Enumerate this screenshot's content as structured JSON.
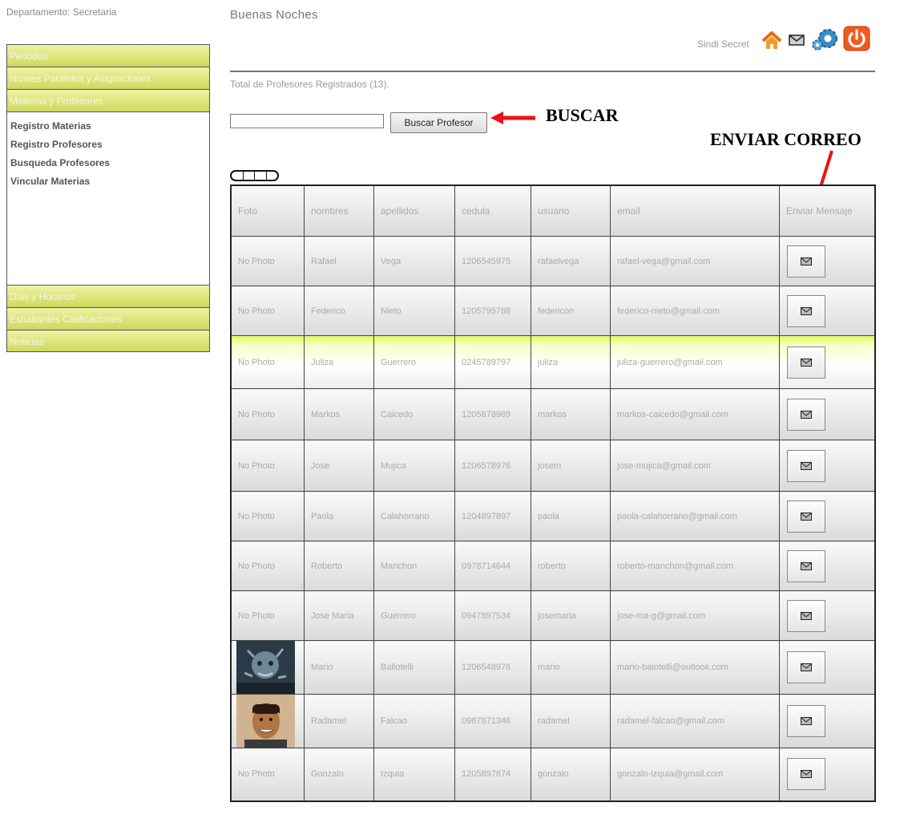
{
  "sidebar": {
    "department": "Departamento: Secretaria",
    "menu_top": [
      "Periodos",
      "Niveles Paralelos y Asignaciones",
      "Materias y Profesores"
    ],
    "sub_items": [
      "Registro Materias",
      "Registro Profesores",
      "Busqueda Profesores",
      "Vincular Materias"
    ],
    "menu_bottom": [
      "Dias y Horarios",
      "Estudiantes Calificaciones",
      "Noticias"
    ]
  },
  "header": {
    "greeting": "Buenas Noches",
    "user": "Sindi Secret",
    "icons": [
      "home-icon",
      "mail-icon",
      "settings-icon",
      "power-icon"
    ]
  },
  "main": {
    "total_text": "Total de Profesores Registrados (13).",
    "search": {
      "value": "",
      "button_label": "Buscar Profesor"
    },
    "annotations": {
      "buscar": "BUSCAR",
      "enviar": "ENVIAR CORREO"
    }
  },
  "table": {
    "columns": [
      "Foto",
      "nombres",
      "apellidos",
      "cedula",
      "usuario",
      "email",
      "Enviar Mensaje"
    ],
    "rows": [
      {
        "foto": "No Photo",
        "nombres": "Rafael",
        "apellidos": "Vega",
        "cedula": "1206545975",
        "usuario": "rafaelvega",
        "email": "rafael-vega@gmail.com"
      },
      {
        "foto": "No Photo",
        "nombres": "Federico",
        "apellidos": "Nieto",
        "cedula": "1205795788",
        "usuario": "federicon",
        "email": "federico-nieto@gmail.com"
      },
      {
        "foto": "No Photo",
        "nombres": "Juliza",
        "apellidos": "Guerrero",
        "cedula": "0245789797",
        "usuario": "juliza",
        "email": "juliza-guerrero@gmail.com",
        "highlight": true
      },
      {
        "foto": "No Photo",
        "nombres": "Markos",
        "apellidos": "Caicedo",
        "cedula": "1205878989",
        "usuario": "markos",
        "email": "markos-caicedo@gmail.com"
      },
      {
        "foto": "No Photo",
        "nombres": "Jose",
        "apellidos": "Mujica",
        "cedula": "1206578976",
        "usuario": "josem",
        "email": "jose-mujica@gmail.com"
      },
      {
        "foto": "No Photo",
        "nombres": "Paola",
        "apellidos": "Calahorrano",
        "cedula": "1204897897",
        "usuario": "paola",
        "email": "paola-calahorrano@gmail.com"
      },
      {
        "foto": "No Photo",
        "nombres": "Roberto",
        "apellidos": "Manchon",
        "cedula": "0978714644",
        "usuario": "roberto",
        "email": "roberto-manchon@gmail.com"
      },
      {
        "foto": "No Photo",
        "nombres": "Jose Maria",
        "apellidos": "Guerrero",
        "cedula": "0947897534",
        "usuario": "josemaria",
        "email": "jose-ma-g@gmail.com"
      },
      {
        "foto": "photo",
        "nombres": "Mario",
        "apellidos": "Ballotelli",
        "cedula": "1206548976",
        "usuario": "mario",
        "email": "mario-balotelli@outlook.com"
      },
      {
        "foto": "photo",
        "nombres": "Radamel",
        "apellidos": "Falcao",
        "cedula": "0987871346",
        "usuario": "radamel",
        "email": "radamel-falcao@gmail.com"
      },
      {
        "foto": "No Photo",
        "nombres": "Gonzalo",
        "apellidos": "Izquia",
        "cedula": "1205897874",
        "usuario": "gonzalo",
        "email": "gonzalo-izquia@gmail.com"
      }
    ]
  },
  "colors": {
    "menu": "#dde57a",
    "highlight": "#dfff3c",
    "annotation_arrow": "#ee1111"
  }
}
